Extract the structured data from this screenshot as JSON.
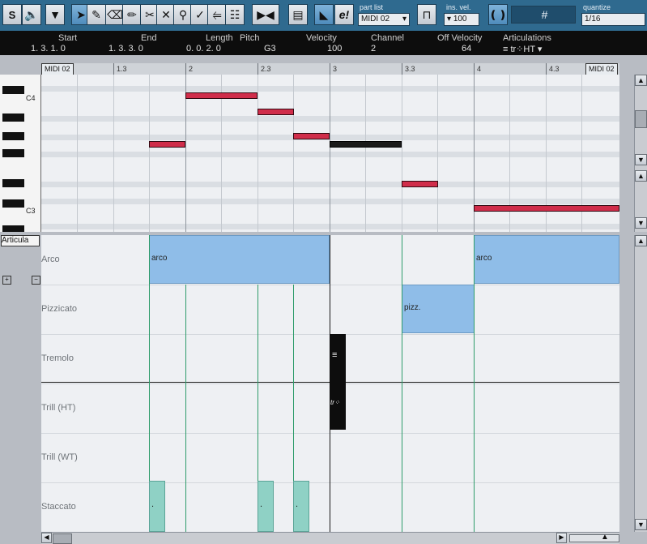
{
  "toolbar": {
    "solo_label": "S",
    "part_list_label": "part list",
    "part_list_value": "MIDI 02",
    "ins_vel_label": "ins. vel.",
    "ins_vel_value": "100",
    "quantize_label": "quantize",
    "quantize_value": "1/16",
    "grid_symbol": "#",
    "icons": [
      "solo-icon",
      "speaker-icon",
      "show-info-icon",
      "arrow-icon",
      "pencil-icon",
      "eraser-icon",
      "draw-icon",
      "knife-icon",
      "delete-x-icon",
      "zoom-icon",
      "mute-icon",
      "line-icon",
      "drumstick-icon",
      "transport-icon",
      "step-input-icon",
      "step-mode-icon",
      "expression-map-icon",
      "length-icon",
      "snap-icon",
      "quantize-icon"
    ]
  },
  "infoline": {
    "headers": [
      "Start",
      "End",
      "Length",
      "Pitch",
      "Velocity",
      "Channel",
      "Off Velocity",
      "Articulations"
    ],
    "values": [
      "1. 3. 1.   0",
      "1. 3. 3.   0",
      "0. 0. 2.   0",
      "G3",
      "100",
      "2",
      "64",
      "trem/trill"
    ]
  },
  "ruler": {
    "ticks": [
      "1.3",
      "2",
      "2.3",
      "3",
      "3.3",
      "4",
      "4.3"
    ],
    "left_locator": "MIDI 02",
    "right_locator": "MIDI 02"
  },
  "keyboard": {
    "labels": [
      "C4",
      "C3"
    ]
  },
  "articulation_header": "Articula",
  "articulations": {
    "rows": [
      "Arco",
      "Pizzicato",
      "Tremolo",
      "Trill (HT)",
      "Trill (WT)",
      "Staccato"
    ],
    "arco_label": "arco",
    "pizz_label": "pizz.",
    "staccato_mark": "."
  },
  "colors": {
    "toolbar": "#2f6a8f",
    "note": "#d02d4a",
    "selected_note": "#1a1a1a",
    "articulation": "#8fbde8",
    "staccato": "#8fd1c5"
  }
}
